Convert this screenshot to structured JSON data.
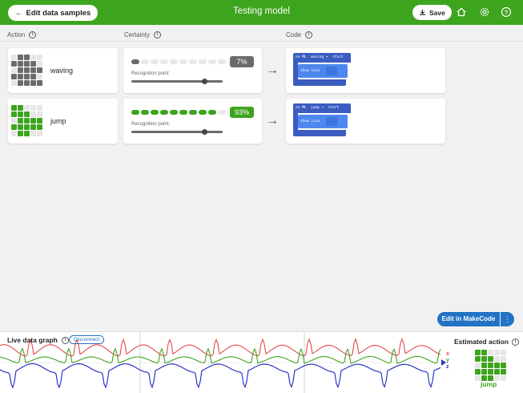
{
  "header": {
    "back_label": "Edit data samples",
    "title": "Testing model",
    "save_label": "Save",
    "color": "#3da41e"
  },
  "columns": {
    "action": "Action",
    "certainty": "Certainty",
    "code": "Code"
  },
  "actions": [
    {
      "name": "waving",
      "certainty_pct": 7,
      "certainty_label": "7%",
      "badge_color": "#6b6b6b",
      "bar_color": "#6b6b6b",
      "recognition_label": "Recognition point:",
      "recognition_point": 0.8,
      "led_color": "#6b6b6b",
      "leds": [
        0,
        1,
        1,
        0,
        0,
        1,
        1,
        1,
        1,
        0,
        0,
        1,
        1,
        1,
        1,
        1,
        1,
        1,
        1,
        0,
        0,
        1,
        1,
        1,
        1
      ],
      "code": {
        "event": "on ML",
        "action": "waving",
        "trigger": "start",
        "inner": "show icon"
      }
    },
    {
      "name": "jump",
      "certainty_pct": 93,
      "certainty_label": "93%",
      "badge_color": "#3da41e",
      "bar_color": "#3da41e",
      "recognition_label": "Recognition point:",
      "recognition_point": 0.8,
      "led_color": "#3da41e",
      "leds": [
        1,
        1,
        0,
        0,
        0,
        1,
        1,
        1,
        0,
        0,
        0,
        1,
        1,
        1,
        1,
        1,
        1,
        1,
        1,
        1,
        0,
        1,
        1,
        0,
        0
      ],
      "code": {
        "event": "on ML",
        "action": "jump",
        "trigger": "start",
        "inner": "show icon"
      }
    }
  ],
  "bottom": {
    "makecode_label": "Edit in MakeCode",
    "more_label": "⋮",
    "graph_title": "Live data graph",
    "disconnect_label": "Disconnect",
    "estimated_title": "Estimated action",
    "estimated_value": "jump",
    "axes": [
      "x",
      "y",
      "z"
    ],
    "axis_colors": [
      "#e04c4c",
      "#3da41e",
      "#2b37c4"
    ]
  }
}
